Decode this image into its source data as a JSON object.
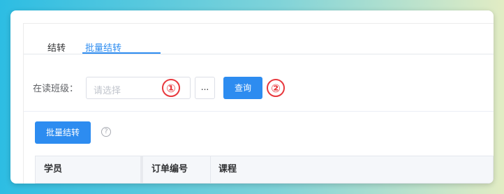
{
  "tabs": [
    {
      "label": "结转"
    },
    {
      "label": "批量结转"
    }
  ],
  "filter": {
    "label": "在读班级：",
    "select_placeholder": "请选择",
    "dots_label": "...",
    "query_label": "查询"
  },
  "annotations": {
    "marker1": "①",
    "marker2": "②"
  },
  "actions": {
    "batch_label": "批量结转",
    "help_glyph": "?"
  },
  "table": {
    "columns": [
      "学员",
      "订单编号",
      "课程"
    ]
  },
  "colors": {
    "accent": "#2d8cf0",
    "marker": "#e8383d"
  }
}
